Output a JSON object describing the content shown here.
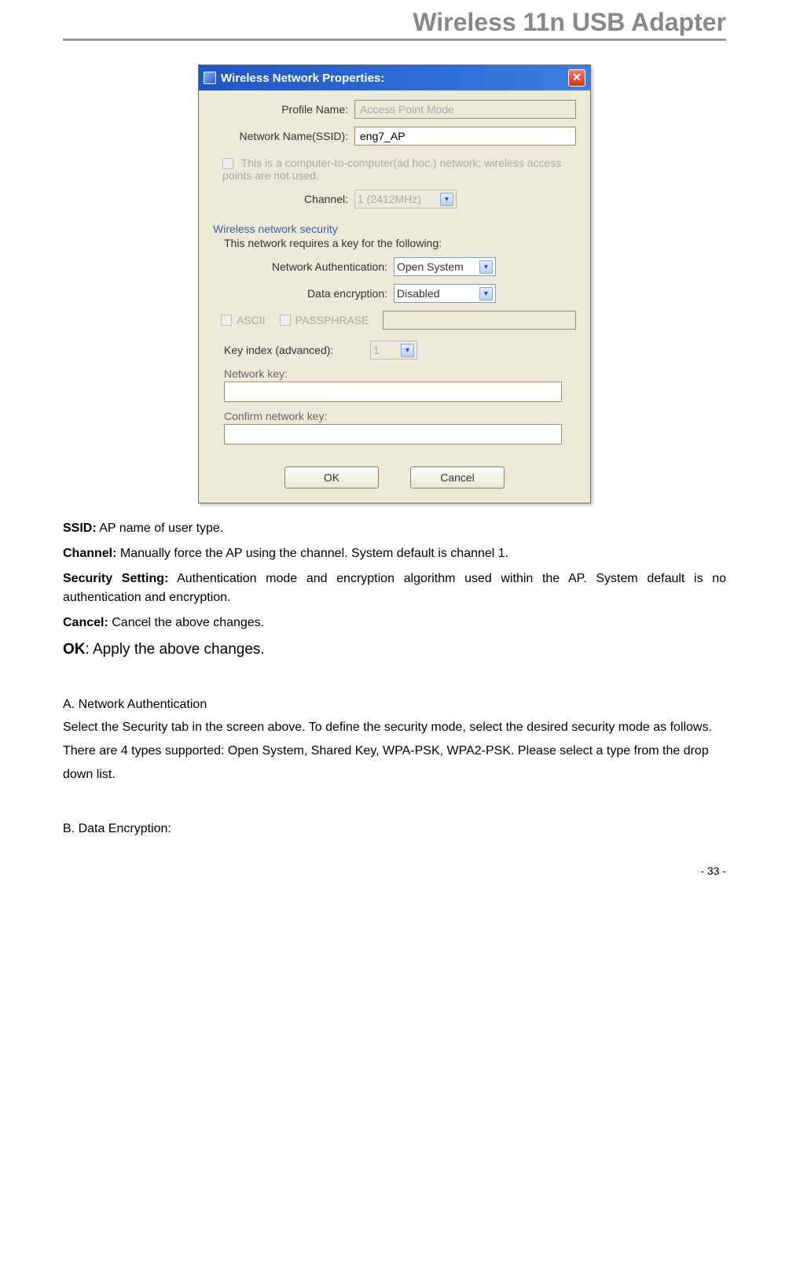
{
  "header": {
    "title": "Wireless 11n USB Adapter"
  },
  "dialog": {
    "title": "Wireless Network Properties:",
    "close_glyph": "✕",
    "profile_name_label": "Profile Name:",
    "profile_name_value": "Access Point Mode",
    "ssid_label": "Network Name(SSID):",
    "ssid_value": "eng7_AP",
    "adhoc_text": "This is a computer-to-computer(ad hoc.) network; wireless access points are not used.",
    "channel_label": "Channel:",
    "channel_value": "1 (2412MHz)",
    "security_section": "Wireless network security",
    "security_sub": "This network requires a key for the following:",
    "auth_label": "Network Authentication:",
    "auth_value": "Open System",
    "enc_label": "Data encryption:",
    "enc_value": "Disabled",
    "ascii_label": "ASCII",
    "pass_label": "PASSPHRASE",
    "keyidx_label": "Key index (advanced):",
    "keyidx_value": "1",
    "netkey_label": "Network key:",
    "confirm_label": "Confirm network key:",
    "ok_label": "OK",
    "cancel_label": "Cancel"
  },
  "doc": {
    "ssid_bold": "SSID:",
    "ssid_text": " AP name of user type.",
    "channel_bold": "Channel:",
    "channel_text": " Manually force the AP using the channel. System default is channel 1.",
    "sec_bold": "Security Setting:",
    "sec_text": " Authentication mode and encryption algorithm used within the AP. System default is no authentication and encryption.",
    "cancel_bold": "Cancel:",
    "cancel_text": " Cancel the above changes.",
    "ok_bold": "OK",
    "ok_text": ": Apply the above changes.",
    "sectA_head": "A. Network Authentication",
    "sectA_body": "Select the Security tab in the screen above. To define the security mode, select the desired security mode as follows. There are 4 types supported: Open System, Shared Key, WPA-PSK, WPA2-PSK. Please select a type from the drop down list.",
    "sectB_head": "B. Data Encryption:"
  },
  "footer": {
    "page": "- 33 -"
  }
}
